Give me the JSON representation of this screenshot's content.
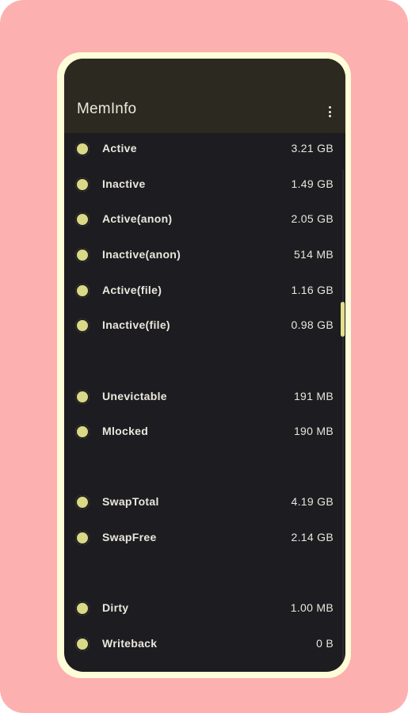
{
  "app": {
    "title": "MemInfo",
    "overflow_icon": "more-vert-icon"
  },
  "colors": {
    "background": "#fdb0b0",
    "frame": "#fffcd8",
    "screen": "#1d1c20",
    "appbar": "#2c2a20",
    "accent": "#d9d987",
    "text": "#e9e7dc"
  },
  "items": [
    {
      "label": "Active",
      "value": "3.21 GB"
    },
    {
      "label": "Inactive",
      "value": "1.49 GB"
    },
    {
      "label": "Active(anon)",
      "value": "2.05 GB"
    },
    {
      "label": "Inactive(anon)",
      "value": "514 MB"
    },
    {
      "label": "Active(file)",
      "value": "1.16 GB"
    },
    {
      "label": "Inactive(file)",
      "value": "0.98 GB"
    },
    {
      "label": "Unevictable",
      "value": "191 MB"
    },
    {
      "label": "Mlocked",
      "value": "190 MB"
    },
    {
      "label": "SwapTotal",
      "value": "4.19 GB"
    },
    {
      "label": "SwapFree",
      "value": "2.14 GB"
    },
    {
      "label": "Dirty",
      "value": "1.00 MB"
    },
    {
      "label": "Writeback",
      "value": "0 B"
    }
  ]
}
